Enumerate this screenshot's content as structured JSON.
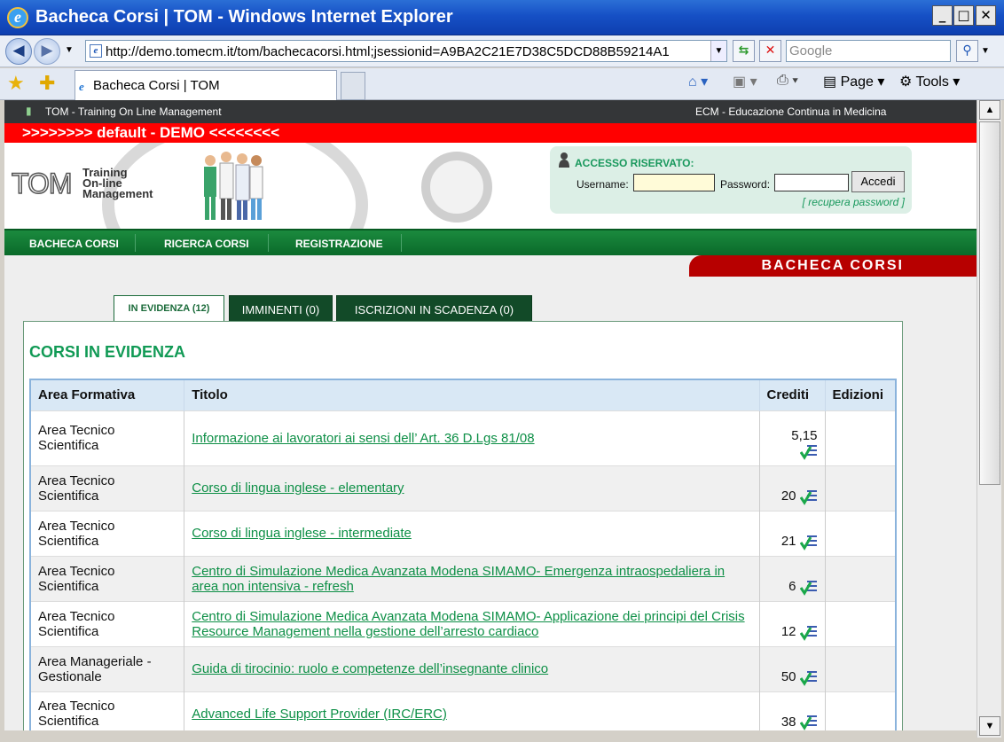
{
  "window": {
    "title": "Bacheca Corsi | TOM - Windows Internet Explorer",
    "ie_glyph": "e",
    "buttons": [
      "_",
      "□",
      "✕"
    ]
  },
  "addressbar": {
    "url": "http://demo.tomecm.it/tom/bachecacorsi.html;jsessionid=A9BA2C21E7D38C5DCD88B59214A1",
    "search_placeholder": "Google"
  },
  "commandbar": {
    "tab_title": "Bacheca Corsi | TOM",
    "page_label": "Page",
    "tools_label": "Tools"
  },
  "site": {
    "top_left": "TOM - Training On Line Management",
    "top_right": "ECM - Educazione Continua in Medicina",
    "banner": ">>>>>>>> default - DEMO <<<<<<<<",
    "logo_main": "TOM",
    "logo_sub": [
      "Training",
      "On-line",
      "Management"
    ]
  },
  "login": {
    "title": "ACCESSO RISERVATO:",
    "username_label": "Username:",
    "password_label": "Password:",
    "button": "Accedi",
    "recover": "[ recupera password ]"
  },
  "nav": [
    "BACHECA CORSI",
    "RICERCA CORSI",
    "REGISTRAZIONE"
  ],
  "section_title": "BACHECA CORSI",
  "tabs": [
    {
      "label": "IN EVIDENZA (12)",
      "active": true
    },
    {
      "label": "IMMINENTI (0)",
      "active": false
    },
    {
      "label": "ISCRIZIONI IN SCADENZA (0)",
      "active": false
    }
  ],
  "panel_title": "CORSI IN EVIDENZA",
  "table": {
    "headers": [
      "Area Formativa",
      "Titolo",
      "Crediti",
      "Edizioni"
    ],
    "rows": [
      {
        "area": "Area Tecnico Scientifica",
        "title": "Informazione ai lavoratori ai sensi dell’ Art. 36 D.Lgs 81/08",
        "credits": "5,15"
      },
      {
        "area": "Area Tecnico Scientifica",
        "title": "Corso di lingua inglese - elementary",
        "credits": "20"
      },
      {
        "area": "Area Tecnico Scientifica",
        "title": "Corso di lingua inglese - intermediate",
        "credits": "21"
      },
      {
        "area": "Area Tecnico Scientifica",
        "title": "Centro di Simulazione Medica Avanzata Modena SIMAMO- Emergenza intraospedaliera in area non intensiva - refresh",
        "credits": "6"
      },
      {
        "area": "Area Tecnico Scientifica",
        "title": "Centro di Simulazione Medica Avanzata Modena SIMAMO- Applicazione dei principi del Crisis Resource Management nella gestione dell’arresto cardiaco",
        "credits": "12"
      },
      {
        "area": "Area Manageriale - Gestionale",
        "title": "Guida di tirocinio: ruolo e competenze dell’insegnante clinico",
        "credits": "50"
      },
      {
        "area": "Area Tecnico Scientifica",
        "title": "Advanced Life Support Provider (IRC/ERC)",
        "credits": "38"
      }
    ]
  }
}
